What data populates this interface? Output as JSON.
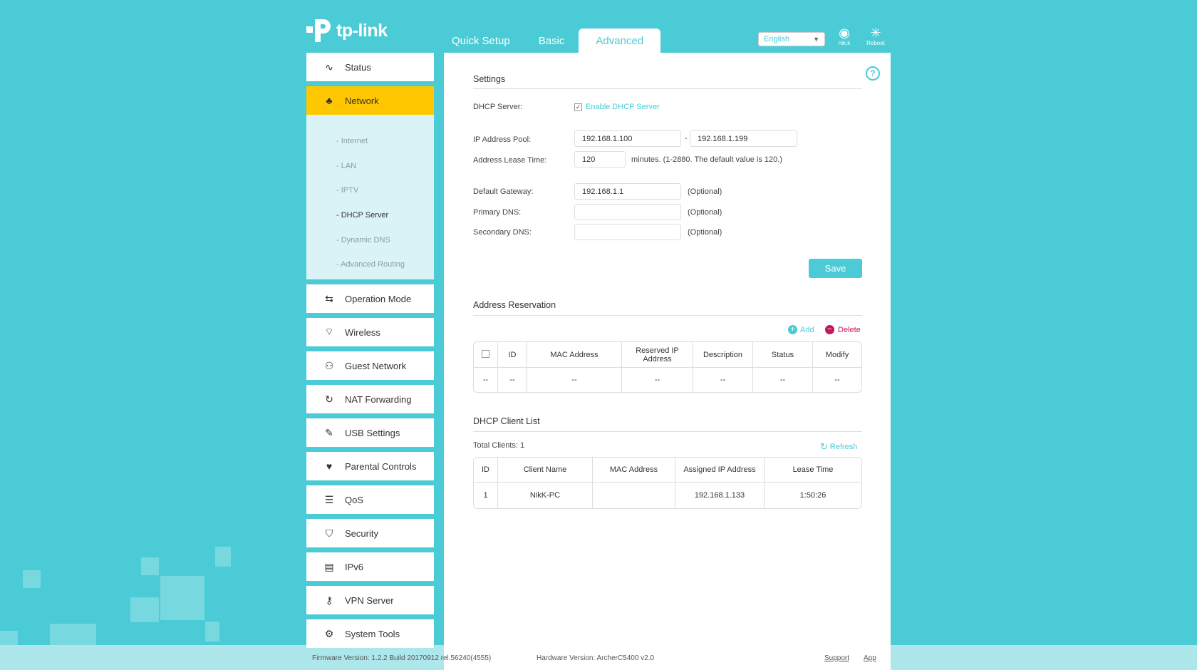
{
  "brand": {
    "name": "tp-link"
  },
  "topnav": {
    "tabs": [
      {
        "label": "Quick Setup"
      },
      {
        "label": "Basic"
      },
      {
        "label": "Advanced"
      }
    ],
    "language": "English",
    "user": {
      "label": "nik.k",
      "icon": "user-icon"
    },
    "reboot": {
      "label": "Reboot",
      "icon": "reboot-icon"
    }
  },
  "sidebar": {
    "items": [
      {
        "label": "Status",
        "icon": "pulse-icon"
      },
      {
        "label": "Network",
        "icon": "network-icon"
      },
      {
        "label": "Operation Mode",
        "icon": "operation-mode-icon"
      },
      {
        "label": "Wireless",
        "icon": "wifi-icon"
      },
      {
        "label": "Guest Network",
        "icon": "guest-icon"
      },
      {
        "label": "NAT Forwarding",
        "icon": "nat-icon"
      },
      {
        "label": "USB Settings",
        "icon": "usb-icon"
      },
      {
        "label": "Parental Controls",
        "icon": "parental-icon"
      },
      {
        "label": "QoS",
        "icon": "qos-icon"
      },
      {
        "label": "Security",
        "icon": "shield-icon"
      },
      {
        "label": "IPv6",
        "icon": "ipv6-icon"
      },
      {
        "label": "VPN Server",
        "icon": "key-icon"
      },
      {
        "label": "System Tools",
        "icon": "gear-icon"
      }
    ],
    "network_sub": [
      "- Internet",
      "- LAN",
      "- IPTV",
      "- DHCP Server",
      "- Dynamic DNS",
      "- Advanced Routing"
    ]
  },
  "settings": {
    "title": "Settings",
    "dhcp_server_label": "DHCP Server:",
    "enable_label": "Enable DHCP Server",
    "enabled": true,
    "pool_label": "IP Address Pool:",
    "pool_start": "192.168.1.100",
    "pool_sep": "-",
    "pool_end": "192.168.1.199",
    "lease_label": "Address Lease Time:",
    "lease_value": "120",
    "lease_note": "minutes. (1-2880. The default value is 120.)",
    "gateway_label": "Default Gateway:",
    "gateway_value": "192.168.1.1",
    "primary_dns_label": "Primary DNS:",
    "primary_dns_value": "",
    "secondary_dns_label": "Secondary DNS:",
    "secondary_dns_value": "",
    "optional": "(Optional)",
    "save": "Save"
  },
  "reservation": {
    "title": "Address Reservation",
    "add": "Add",
    "delete": "Delete",
    "columns": [
      "ID",
      "MAC Address",
      "Reserved IP Address",
      "Description",
      "Status",
      "Modify"
    ],
    "rows": [
      [
        "--",
        "--",
        "--",
        "--",
        "--",
        "--",
        "--"
      ]
    ]
  },
  "clients": {
    "title": "DHCP Client List",
    "total": "Total Clients: 1",
    "refresh": "Refresh",
    "columns": [
      "ID",
      "Client Name",
      "MAC Address",
      "Assigned IP Address",
      "Lease Time"
    ],
    "rows": [
      [
        "1",
        "NikK-PC",
        "",
        "192.168.1.133",
        "1:50:26"
      ]
    ]
  },
  "footer": {
    "firmware": "Firmware Version: 1.2.2 Build 20170912 rel.56240(4555)",
    "hardware": "Hardware Version: ArcherC5400 v2.0",
    "support": "Support",
    "app": "App"
  },
  "colors": {
    "accent": "#4acbd6",
    "active": "#ffc700",
    "delete": "#c0185e"
  }
}
